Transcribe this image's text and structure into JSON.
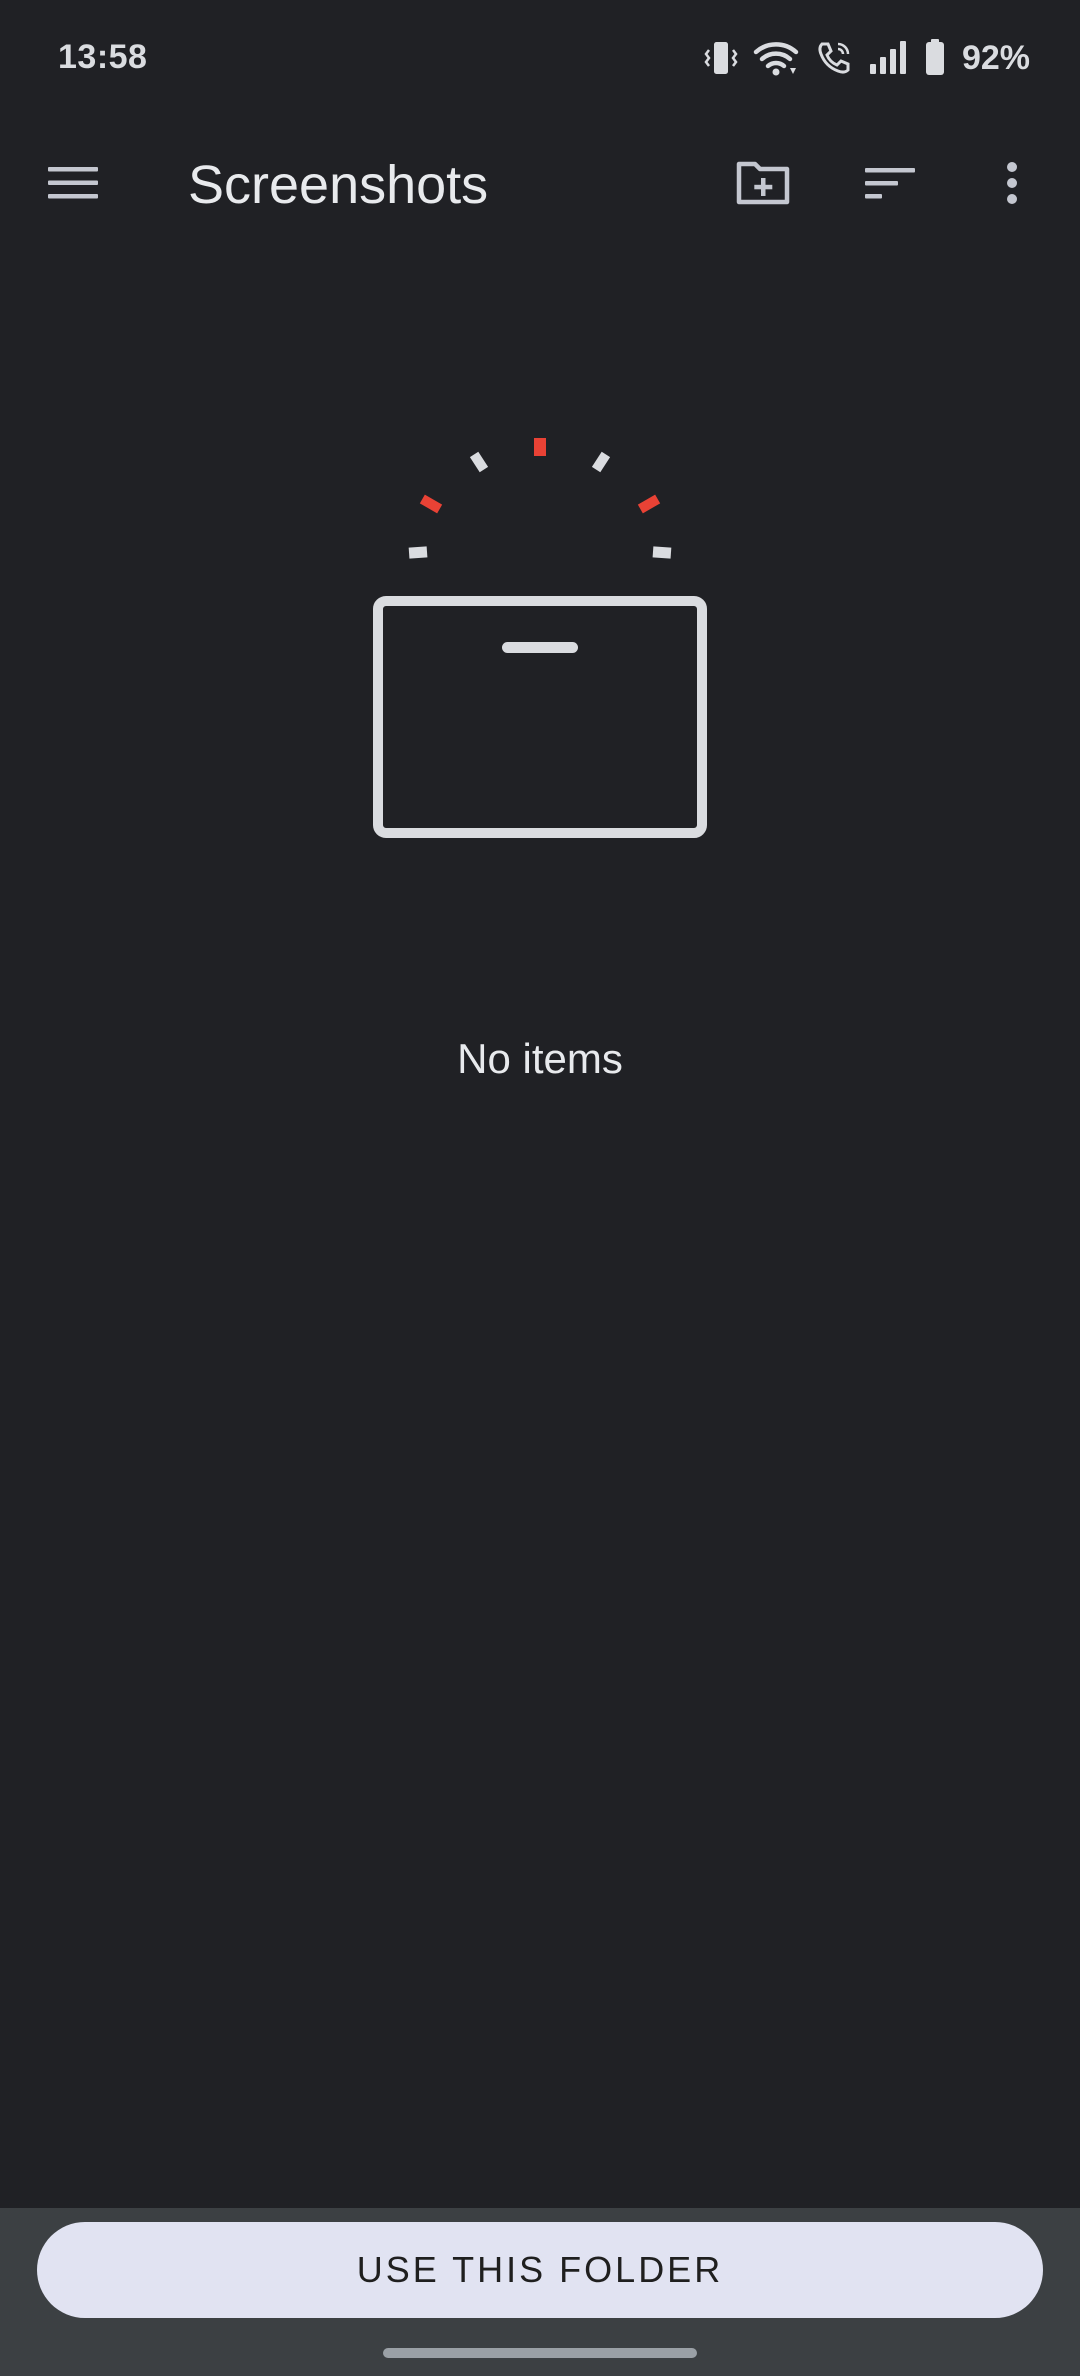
{
  "status_bar": {
    "time": "13:58",
    "battery": "92%",
    "icons": [
      "vibrate-icon",
      "wifi-icon",
      "wifi-calling-icon",
      "signal-icon",
      "battery-icon"
    ]
  },
  "toolbar": {
    "title": "Screenshots",
    "icons": [
      "menu-icon",
      "new-folder-icon",
      "sort-icon",
      "more-vert-icon"
    ]
  },
  "empty_state": {
    "message": "No items",
    "illustration": "empty-box-icon",
    "accent_color": "#e94235",
    "line_color": "#dadce0"
  },
  "bottom": {
    "button_label": "USE THIS FOLDER"
  },
  "colors": {
    "background": "#202125",
    "bottom_bar": "#3c4043",
    "button_bg": "#e1e3f2"
  }
}
